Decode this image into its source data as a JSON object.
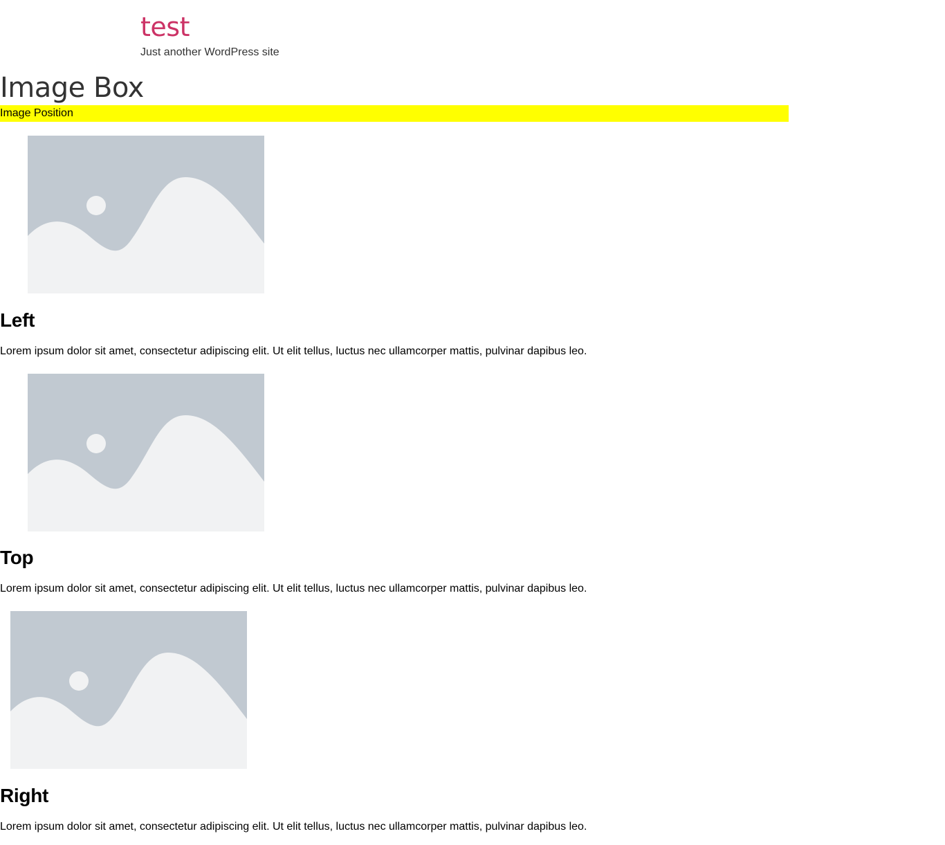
{
  "site": {
    "title": "test",
    "tagline": "Just another WordPress site"
  },
  "page": {
    "title": "Image Box"
  },
  "section": {
    "label": "Image Position",
    "highlight_color": "#ffff00"
  },
  "image_boxes": [
    {
      "title": "Left",
      "description": "Lorem ipsum dolor sit amet, consectetur adipiscing elit. Ut elit tellus, luctus nec ullamcorper mattis, pulvinar dapibus leo.",
      "image_icon": "image-placeholder-icon"
    },
    {
      "title": "Top",
      "description": "Lorem ipsum dolor sit amet, consectetur adipiscing elit. Ut elit tellus, luctus nec ullamcorper mattis, pulvinar dapibus leo.",
      "image_icon": "image-placeholder-icon"
    },
    {
      "title": "Right",
      "description": "Lorem ipsum dolor sit amet, consectetur adipiscing elit. Ut elit tellus, luctus nec ullamcorper mattis, pulvinar dapibus leo.",
      "image_icon": "image-placeholder-icon"
    }
  ],
  "colors": {
    "accent": "#cc3366",
    "placeholder_sky": "#c1c9d1",
    "placeholder_land": "#f1f2f3"
  }
}
